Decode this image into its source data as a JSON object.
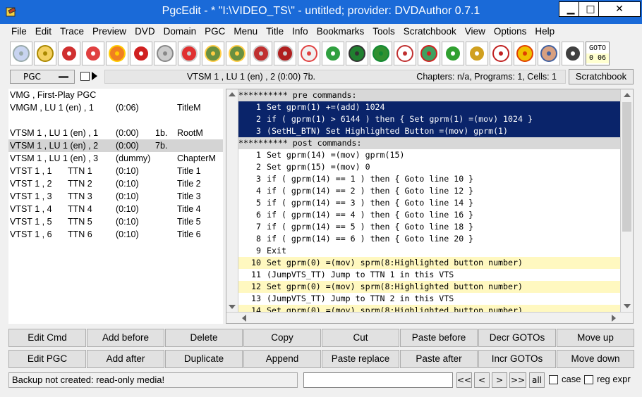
{
  "window": {
    "title": "PgcEdit - * \"I:\\VIDEO_TS\\\" - untitled; provider: DVDAuthor 0.7.1",
    "minimize": "▁",
    "maximize": "□",
    "close": "✕"
  },
  "menu": [
    "File",
    "Edit",
    "Trace",
    "Preview",
    "DVD",
    "Domain",
    "PGC",
    "Menu",
    "Title",
    "Info",
    "Bookmarks",
    "Tools",
    "Scratchbook",
    "View",
    "Options",
    "Help"
  ],
  "toolbar": {
    "icons": [
      "dvd-open-icon",
      "folder-open-icon",
      "dvd-reload-icon",
      "dvd-new-icon",
      "burn-icon",
      "dvd-search-icon",
      "dvds-copy-icon",
      "dvd-bookmark-icon",
      "import-icon",
      "export-icon",
      "dvd-check-icon",
      "dvd-id-icon",
      "document-icon",
      "globe-icon",
      "play-film-icon",
      "bug-icon",
      "checklist-icon",
      "delete-cells-icon",
      "menu-icon",
      "chain-link-icon",
      "grid-numbers-icon",
      "tcl-icon",
      "eye-icon",
      "trace-icon"
    ],
    "goto_label": "GOTO",
    "goto_value": "0 06"
  },
  "info": {
    "pgc_select": "PGC",
    "current_pgc": "VTSM 1 , LU 1 (en) , 2  (0:00)  7b.",
    "stats": "Chapters: n/a,  Programs: 1,  Cells: 1",
    "scratchbook": "Scratchbook"
  },
  "pgc_list": [
    {
      "c0": "VMG , First-Play PGC",
      "c1": "",
      "c2": "",
      "c3": "",
      "c4": ""
    },
    {
      "c0": "VMGM , LU 1 (en) , 1",
      "c1": "",
      "c2": "(0:06)",
      "c3": "",
      "c4": "TitleM"
    },
    {
      "c0": "",
      "c1": "",
      "c2": "",
      "c3": "",
      "c4": ""
    },
    {
      "c0": "VTSM 1 , LU 1 (en) , 1",
      "c1": "",
      "c2": "(0:00)",
      "c3": "1b.",
      "c4": "RootM"
    },
    {
      "c0": "VTSM 1 , LU 1 (en) , 2",
      "c1": "",
      "c2": "(0:00)",
      "c3": "7b.",
      "c4": ""
    },
    {
      "c0": "VTSM 1 , LU 1 (en) , 3",
      "c1": "",
      "c2": "(dummy)",
      "c3": "",
      "c4": "ChapterM"
    },
    {
      "c0": "VTST 1 , 1",
      "c1": "TTN 1",
      "c2": "(0:10)",
      "c3": "",
      "c4": "Title 1"
    },
    {
      "c0": "VTST 1 , 2",
      "c1": "TTN 2",
      "c2": "(0:10)",
      "c3": "",
      "c4": "Title 2"
    },
    {
      "c0": "VTST 1 , 3",
      "c1": "TTN 3",
      "c2": "(0:10)",
      "c3": "",
      "c4": "Title 3"
    },
    {
      "c0": "VTST 1 , 4",
      "c1": "TTN 4",
      "c2": "(0:10)",
      "c3": "",
      "c4": "Title 4"
    },
    {
      "c0": "VTST 1 , 5",
      "c1": "TTN 5",
      "c2": "(0:10)",
      "c3": "",
      "c4": "Title 5"
    },
    {
      "c0": "VTST 1 , 6",
      "c1": "TTN 6",
      "c2": "(0:10)",
      "c3": "",
      "c4": "Title 6"
    }
  ],
  "selected_pgc_index": 4,
  "commands": [
    {
      "kind": "section",
      "ln": "",
      "text": "********** pre commands:"
    },
    {
      "kind": "sel",
      "ln": "1",
      "text": "Set gprm(1) +=(add) 1024"
    },
    {
      "kind": "sel",
      "ln": "2",
      "text": "if ( gprm(1) > 6144 ) then { Set gprm(1) =(mov) 1024 }"
    },
    {
      "kind": "sel",
      "ln": "3",
      "text": "(SetHL_BTN) Set Highlighted Button =(mov) gprm(1)"
    },
    {
      "kind": "section",
      "ln": "",
      "text": "********** post commands:"
    },
    {
      "kind": "normal",
      "ln": "1",
      "text": "Set gprm(14) =(mov) gprm(15)"
    },
    {
      "kind": "normal",
      "ln": "2",
      "text": "Set gprm(15) =(mov) 0"
    },
    {
      "kind": "normal",
      "ln": "3",
      "text": "if ( gprm(14) == 1 ) then { Goto line 10 }"
    },
    {
      "kind": "normal",
      "ln": "4",
      "text": "if ( gprm(14) == 2 ) then { Goto line 12 }"
    },
    {
      "kind": "normal",
      "ln": "5",
      "text": "if ( gprm(14) == 3 ) then { Goto line 14 }"
    },
    {
      "kind": "normal",
      "ln": "6",
      "text": "if ( gprm(14) == 4 ) then { Goto line 16 }"
    },
    {
      "kind": "normal",
      "ln": "7",
      "text": "if ( gprm(14) == 5 ) then { Goto line 18 }"
    },
    {
      "kind": "normal",
      "ln": "8",
      "text": "if ( gprm(14) == 6 ) then { Goto line 20 }"
    },
    {
      "kind": "normal",
      "ln": "9",
      "text": "Exit"
    },
    {
      "kind": "hl",
      "ln": "10",
      "text": "Set gprm(0) =(mov) sprm(8:Highlighted button number)"
    },
    {
      "kind": "normal",
      "ln": "11",
      "text": "(JumpVTS_TT) Jump to TTN 1 in this VTS"
    },
    {
      "kind": "hl",
      "ln": "12",
      "text": "Set gprm(0) =(mov) sprm(8:Highlighted button number)"
    },
    {
      "kind": "normal",
      "ln": "13",
      "text": "(JumpVTS_TT) Jump to TTN 2 in this VTS"
    },
    {
      "kind": "hl",
      "ln": "14",
      "text": "Set gprm(0) =(mov) sprm(8:Highlighted button number)"
    }
  ],
  "actions": {
    "row1": [
      "Edit Cmd",
      "Add before",
      "Delete",
      "Copy",
      "Cut",
      "Paste before",
      "Decr GOTOs",
      "Move up"
    ],
    "row2": [
      "Edit PGC",
      "Add after",
      "Duplicate",
      "Append",
      "Paste replace",
      "Paste after",
      "Incr GOTOs",
      "Move down"
    ]
  },
  "status": {
    "message": "Backup not created: read-only media!",
    "search_value": "",
    "nav_first": "<<",
    "nav_prev": "<",
    "nav_next": ">",
    "nav_last": ">>",
    "all": "all",
    "case": "case",
    "regexpr": "reg expr"
  }
}
